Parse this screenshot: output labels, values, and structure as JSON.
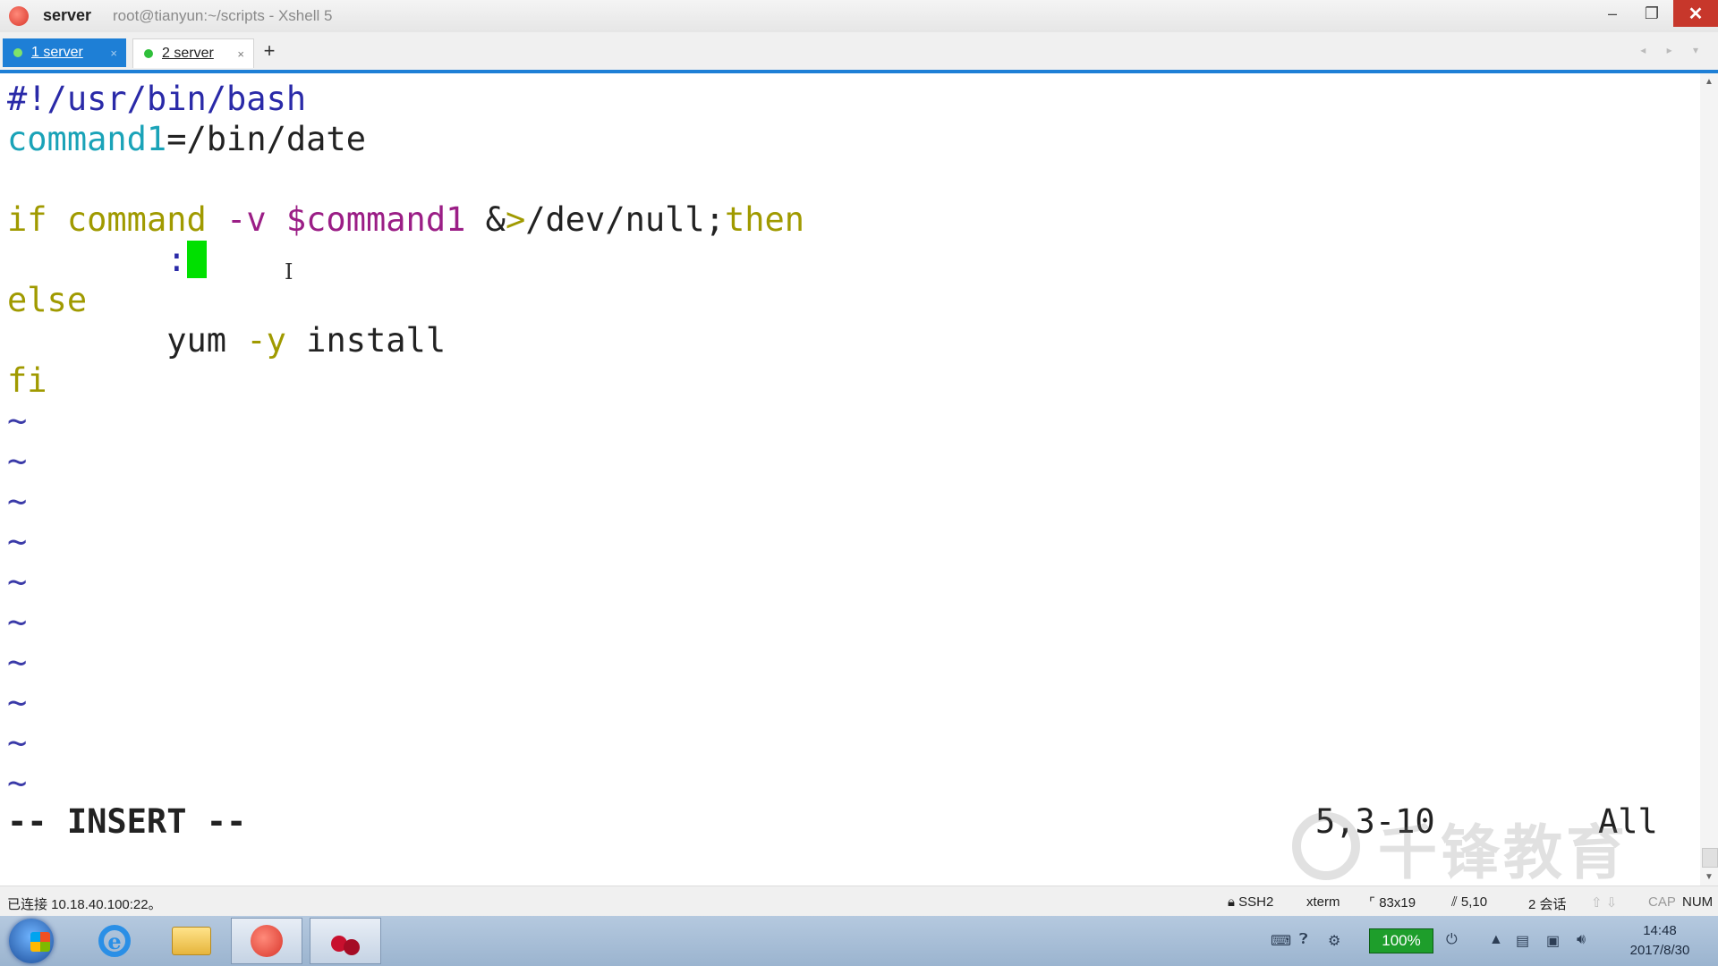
{
  "window": {
    "app_name": "server",
    "title": "root@tianyun:~/scripts - Xshell 5",
    "min_icon": "–",
    "max_icon": "❐",
    "close_icon": "✕"
  },
  "tabs": [
    {
      "label": "1 server",
      "close": "×",
      "active": true
    },
    {
      "label": "2 server",
      "close": "×",
      "active": false
    }
  ],
  "tab_add": "+",
  "tab_nav": "◂ ▸ ▾",
  "editor": {
    "line1": "#!/usr/bin/bash",
    "line2_var": "command1",
    "line2_val": "=/bin/date",
    "line4_if": "if",
    "line4_cmd": " command ",
    "line4_opt": "-v",
    "line4_var": " $command1 ",
    "line4_redirect_a": "&",
    "line4_redirect_b": ">",
    "line4_path": "/dev/null;",
    "line4_then": "then",
    "line5_indent": "        ",
    "line5_colon": ":",
    "line6_else": "else",
    "line7_indent": "        ",
    "line7_yum": "yum ",
    "line7_opt": "-y",
    "line7_install": " install",
    "line8_fi": "fi",
    "tilde": "~",
    "mode": "-- INSERT --",
    "position": "5,3-10",
    "scroll": "All",
    "ibeam": "I"
  },
  "watermark": "千锋教育",
  "status": {
    "connection": "已连接 10.18.40.100:22。",
    "protocol": "SSH2",
    "term": "xterm",
    "size": "83x19",
    "cursor": "5,10",
    "sessions": "2 会话",
    "arrows": "⇧ ⇩",
    "cap": "CAP",
    "num": "NUM"
  },
  "taskbar": {
    "battery": "100%",
    "time": "14:48",
    "date": "2017/8/30",
    "ie_label": "e"
  }
}
